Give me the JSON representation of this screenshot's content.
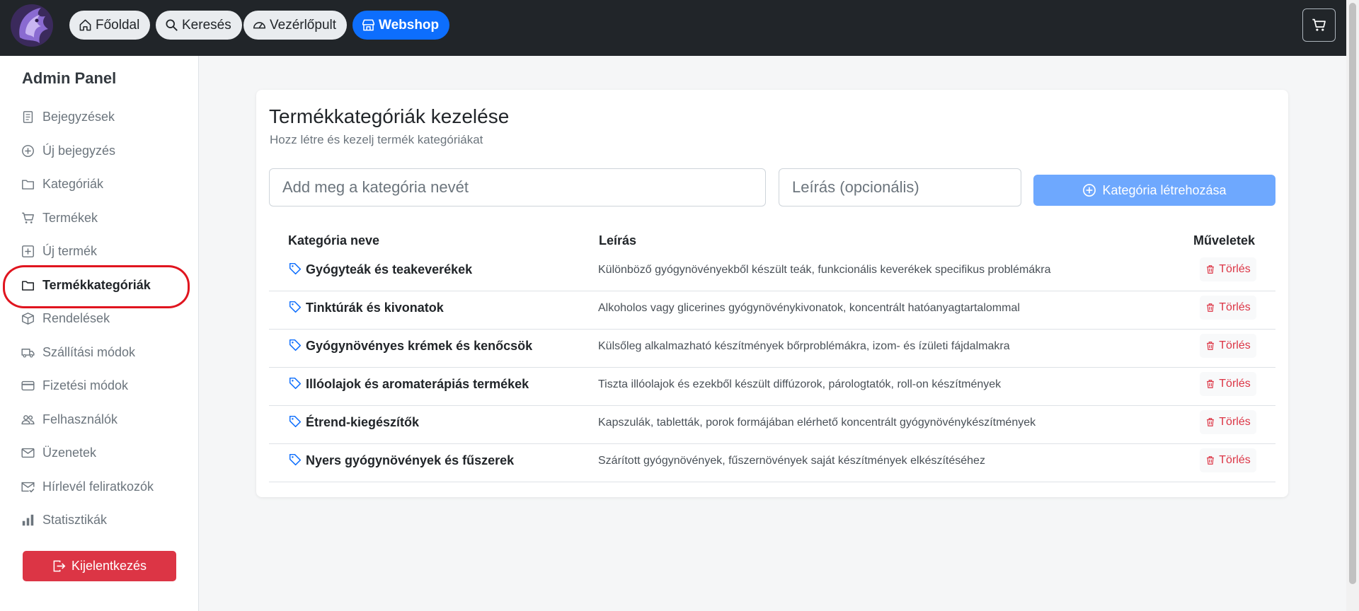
{
  "header": {
    "nav": [
      {
        "label": "Főoldal",
        "icon": "house-icon"
      },
      {
        "label": "Keresés",
        "icon": "search-icon"
      },
      {
        "label": "Vezérlőpult",
        "icon": "speedometer-icon"
      },
      {
        "label": "Webshop",
        "icon": "shop-icon",
        "active": true
      }
    ],
    "cart_icon": "cart-icon",
    "logo": "purple-dragon-logo"
  },
  "sidebar": {
    "title": "Admin Panel",
    "items": [
      {
        "label": "Bejegyzések",
        "icon": "document-icon"
      },
      {
        "label": "Új bejegyzés",
        "icon": "plus-circle-icon"
      },
      {
        "label": "Kategóriák",
        "icon": "folder-icon"
      },
      {
        "label": "Termékek",
        "icon": "cart-icon"
      },
      {
        "label": "Új termék",
        "icon": "plus-square-icon"
      },
      {
        "label": "Termékkategóriák",
        "icon": "folder-icon",
        "active": true
      },
      {
        "label": "Rendelések",
        "icon": "box-icon"
      },
      {
        "label": "Szállítási módok",
        "icon": "truck-icon"
      },
      {
        "label": "Fizetési módok",
        "icon": "credit-card-icon"
      },
      {
        "label": "Felhasználók",
        "icon": "people-icon"
      },
      {
        "label": "Üzenetek",
        "icon": "envelope-icon"
      },
      {
        "label": "Hírlevél feliratkozók",
        "icon": "envelope-check-icon"
      },
      {
        "label": "Statisztikák",
        "icon": "bar-chart-icon"
      }
    ],
    "logout_label": "Kijelentkezés"
  },
  "main": {
    "title": "Termékkategóriák kezelése",
    "subtitle": "Hozz létre és kezelj termék kategóriákat",
    "name_placeholder": "Add meg a kategória nevét",
    "description_placeholder": "Leírás (opcionális)",
    "create_label": "Kategória létrehozása",
    "columns": [
      "Kategória neve",
      "Leírás",
      "Műveletek"
    ],
    "delete_label": "Törlés",
    "rows": [
      {
        "name": "Gyógyteák és teakeverékek",
        "description": "Különböző gyógynövényekből készült teák, funkcionális keverékek specifikus problémákra"
      },
      {
        "name": "Tinktúrák és kivonatok",
        "description": "Alkoholos vagy glicerines gyógynövénykivonatok, koncentrált hatóanyagtartalommal"
      },
      {
        "name": "Gyógynövényes krémek és kenőcsök",
        "description": "Külsőleg alkalmazható készítmények bőrproblémákra, izom- és ízületi fájdalmakra"
      },
      {
        "name": "Illóolajok és aromaterápiás termékek",
        "description": "Tiszta illóolajok és ezekből készült diffúzorok, párologtatók, roll-on készítmények"
      },
      {
        "name": "Étrend-kiegészítők",
        "description": "Kapszulák, tabletták, porok formájában elérhető koncentrált gyógynövénykészítmények"
      },
      {
        "name": "Nyers gyógynövények és fűszerek",
        "description": "Szárított gyógynövények, fűszernövények saját készítmények elkészítéséhez"
      }
    ]
  },
  "colors": {
    "navbar": "#212529",
    "primary": "#0d6efd",
    "primary_disabled": "#6ea8fe",
    "danger": "#dc3545",
    "highlight": "#e0151f"
  }
}
